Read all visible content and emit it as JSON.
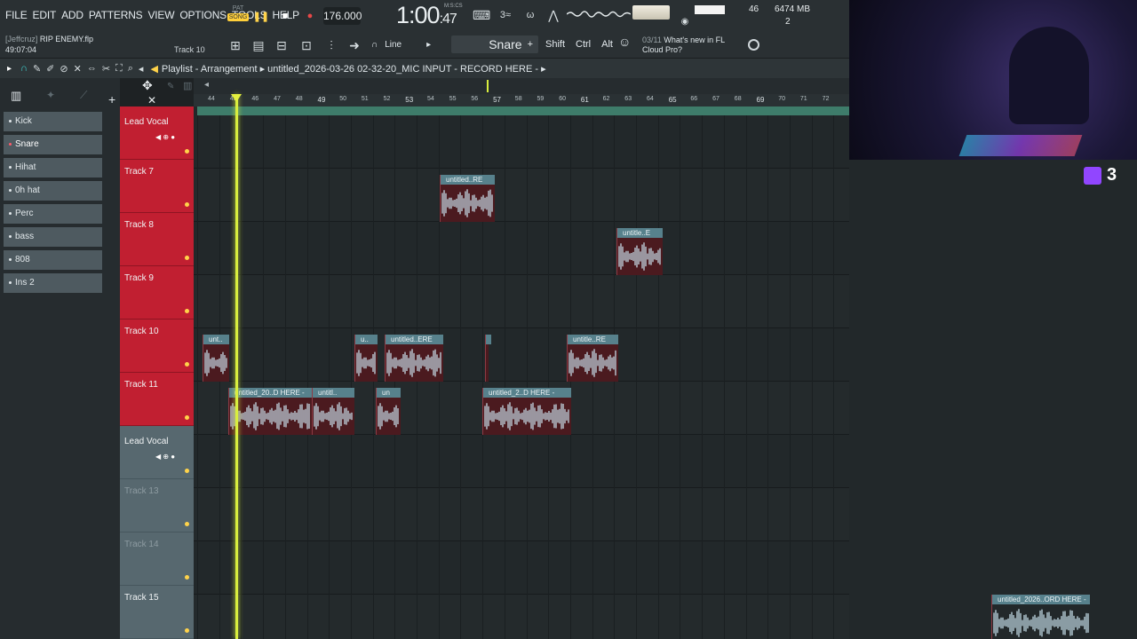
{
  "menu": [
    "FILE",
    "EDIT",
    "ADD",
    "PATTERNS",
    "VIEW",
    "OPTIONS",
    "TOOLS",
    "HELP"
  ],
  "transport": {
    "pat_label": "PAT",
    "song_label": "SONG",
    "tempo": "176.000",
    "time_main": "1:00",
    "time_sec": ":47",
    "time_unit": "M:S:CS",
    "cpu": "46",
    "ram": "6474 MB",
    "poly": "2"
  },
  "project": {
    "user": "[Jeffcruz]",
    "file": "RIP ENEMY.flp",
    "elapsed": "49:07:04",
    "hint_track": "Track 10"
  },
  "toolbar": {
    "snap": "Line",
    "channel": "Snare",
    "mods": [
      "Shift",
      "Ctrl",
      "Alt"
    ],
    "news_date": "03/11",
    "news_text_1": "What's new in FL",
    "news_text_2": "Cloud Pro?"
  },
  "playlist": {
    "label": "Playlist - Arrangement",
    "clip": "untitled_2026-03-26 02-32-20_MIC INPUT - RECORD HERE -"
  },
  "picker": [
    "Kick",
    "Snare",
    "Hihat",
    "0h hat",
    "Perc",
    "bass",
    "808",
    "Ins 2"
  ],
  "ruler": [
    {
      "n": "44",
      "lbl": false
    },
    {
      "n": "45",
      "lbl": false
    },
    {
      "n": "46",
      "lbl": false
    },
    {
      "n": "47",
      "lbl": false
    },
    {
      "n": "48",
      "lbl": false
    },
    {
      "n": "49",
      "lbl": true
    },
    {
      "n": "50",
      "lbl": false
    },
    {
      "n": "51",
      "lbl": false
    },
    {
      "n": "52",
      "lbl": false
    },
    {
      "n": "53",
      "lbl": true
    },
    {
      "n": "54",
      "lbl": false
    },
    {
      "n": "55",
      "lbl": false
    },
    {
      "n": "56",
      "lbl": false
    },
    {
      "n": "57",
      "lbl": true
    },
    {
      "n": "58",
      "lbl": false
    },
    {
      "n": "59",
      "lbl": false
    },
    {
      "n": "60",
      "lbl": false
    },
    {
      "n": "61",
      "lbl": true
    },
    {
      "n": "62",
      "lbl": false
    },
    {
      "n": "63",
      "lbl": false
    },
    {
      "n": "64",
      "lbl": false
    },
    {
      "n": "65",
      "lbl": true
    },
    {
      "n": "66",
      "lbl": false
    },
    {
      "n": "67",
      "lbl": false
    },
    {
      "n": "68",
      "lbl": false
    },
    {
      "n": "69",
      "lbl": true
    },
    {
      "n": "70",
      "lbl": false
    },
    {
      "n": "71",
      "lbl": false
    },
    {
      "n": "72",
      "lbl": false
    }
  ],
  "tracks": [
    {
      "name": "Lead Vocal",
      "style": "red",
      "has_controls": true
    },
    {
      "name": "Track 7",
      "style": "red",
      "has_controls": false
    },
    {
      "name": "Track 8",
      "style": "red",
      "has_controls": false
    },
    {
      "name": "Track 9",
      "style": "red",
      "has_controls": false
    },
    {
      "name": "Track 10",
      "style": "red",
      "has_controls": false
    },
    {
      "name": "Track 11",
      "style": "red",
      "has_controls": false
    },
    {
      "name": "Lead Vocal",
      "style": "blue",
      "has_controls": true
    },
    {
      "name": "Track 13",
      "style": "blue-faded",
      "has_controls": false
    },
    {
      "name": "Track 14",
      "style": "blue-faded",
      "has_controls": false
    },
    {
      "name": "Track 15",
      "style": "blue",
      "has_controls": false
    }
  ],
  "clips": [
    {
      "track": 1,
      "label": "untitled..RE"
    },
    {
      "track": 2,
      "label": "untitle..E"
    },
    {
      "track": 4,
      "label": "unt.."
    },
    {
      "track": 4,
      "label": "u.."
    },
    {
      "track": 4,
      "label": "untitled..ERE"
    },
    {
      "track": 4,
      "label": ""
    },
    {
      "track": 4,
      "label": "untitle..RE"
    },
    {
      "track": 5,
      "label": "untitled_20..D HERE -"
    },
    {
      "track": 5,
      "label": "untitl.."
    },
    {
      "track": 5,
      "label": "un"
    },
    {
      "track": 5,
      "label": "untitled_2..D HERE -"
    }
  ],
  "right_clip": "untitled_2026..ORD HERE -",
  "twitch_count": "3",
  "colors": {
    "track_red": "#c11f31",
    "track_blue": "#57686f",
    "playhead": "#d9ee3e",
    "clip_head": "#57818c"
  }
}
